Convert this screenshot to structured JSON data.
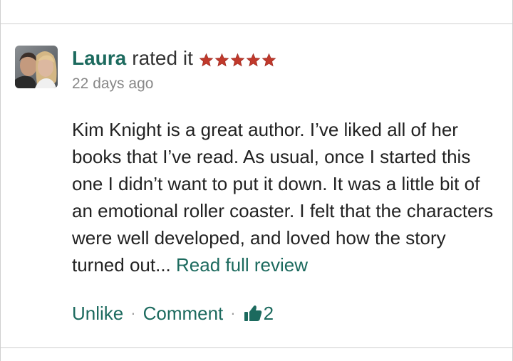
{
  "review": {
    "reviewer_name": "Laura",
    "rated_text": "rated it",
    "rating": 5,
    "rating_max": 5,
    "timestamp": "22 days ago",
    "body_text": "Kim Knight is a great author. I’ve liked all of her books that I’ve read. As usual, once I started this one I didn’t want to put it down. It was a little bit of an emotional roller coaster. I felt that the characters were well developed, and loved how the story turned out...",
    "read_more_label": "Read full review"
  },
  "actions": {
    "unlike_label": "Unlike",
    "separator": "·",
    "comment_label": "Comment",
    "like_count": "2"
  },
  "colors": {
    "link": "#1c6a5e",
    "star": "#c0392b",
    "timestamp": "#888888",
    "divider": "#cfcfcf"
  },
  "icons": {
    "avatar": "reviewer-avatar-photo",
    "star": "star-icon",
    "like": "thumbs-up-icon"
  }
}
